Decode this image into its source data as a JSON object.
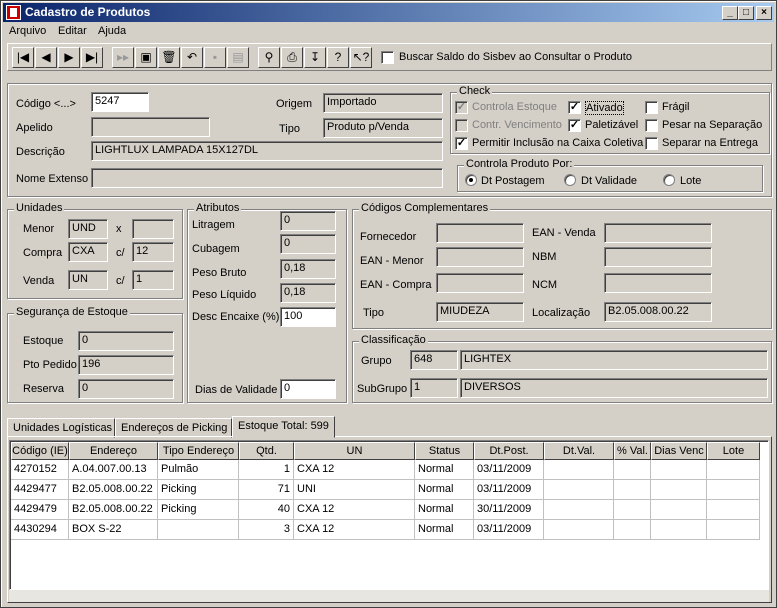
{
  "window": {
    "title": "Cadastro de Produtos"
  },
  "menu": [
    "Arquivo",
    "Editar",
    "Ajuda"
  ],
  "toolbar": {
    "buscar_label": "Buscar Saldo do Sisbev ao Consultar o Produto"
  },
  "produto": {
    "codigo_label": "Código <...>",
    "codigo": "5247",
    "apelido_label": "Apelido",
    "apelido": "",
    "descricao_label": "Descrição",
    "descricao": "LIGHTLUX LAMPADA      15X127DL",
    "nome_extenso_label": "Nome Extenso",
    "nome_extenso": "",
    "origem_label": "Origem",
    "origem": "Importado",
    "tipo_label": "Tipo",
    "tipo": "Produto p/Venda"
  },
  "check": {
    "title": "Check",
    "controla_estoque": "Controla Estoque",
    "ativado": "Ativado",
    "fragil": "Frágil",
    "contr_vencimento": "Contr. Vencimento",
    "paletizavel": "Paletizável",
    "pesar": "Pesar na Separação",
    "permitir": "Permitir Inclusão na Caixa Coletiva",
    "separar": "Separar na Entrega",
    "controla_por": "Controla Produto Por:",
    "dt_postagem": "Dt Postagem",
    "dt_validade": "Dt Validade",
    "lote": "Lote"
  },
  "unidades": {
    "title": "Unidades",
    "menor_label": "Menor",
    "menor": "UND",
    "x": "x",
    "menor_q": "",
    "compra_label": "Compra",
    "compra": "CXA",
    "c1": "c/",
    "compra_q": "12",
    "venda_label": "Venda",
    "venda": "UN",
    "c2": "c/",
    "venda_q": "1"
  },
  "seguranca": {
    "title": "Segurança de Estoque",
    "estoque_label": "Estoque",
    "estoque": "0",
    "pto_label": "Pto Pedido",
    "pto": "196",
    "reserva_label": "Reserva",
    "reserva": "0"
  },
  "atributos": {
    "title": "Atributos",
    "litragem_label": "Litragem",
    "litragem": "0",
    "cubagem_label": "Cubagem",
    "cubagem": "0",
    "peso_bruto_label": "Peso Bruto",
    "peso_bruto": "0,18",
    "peso_liq_label": "Peso Líquido",
    "peso_liq": "0,18",
    "desc_label": "Desc Encaixe (%)",
    "desc": "100",
    "dias_label": "Dias de Validade",
    "dias": "0"
  },
  "codigos": {
    "title": "Códigos Complementares",
    "fornecedor": "Fornecedor",
    "ean_menor": "EAN - Menor",
    "ean_compra": "EAN - Compra",
    "tipo_label": "Tipo",
    "tipo": "MIUDEZA",
    "ean_venda": "EAN - Venda",
    "nbm": "NBM",
    "ncm": "NCM",
    "loc_label": "Localização",
    "loc": "B2.05.008.00.22"
  },
  "classificacao": {
    "title": "Classificação",
    "grupo_label": "Grupo",
    "grupo_cod": "648",
    "grupo": "LIGHTEX",
    "sub_label": "SubGrupo",
    "sub_cod": "1",
    "sub": "DIVERSOS"
  },
  "tabs": [
    "Unidades Logísticas",
    "Endereços de Picking",
    "Estoque Total: 599"
  ],
  "table": {
    "headers": [
      "Código (IE)",
      "Endereço",
      "Tipo Endereço",
      "Qtd.",
      "UN",
      "Status",
      "Dt.Post.",
      "Dt.Val.",
      "% Val.",
      "Dias Venc",
      "Lote"
    ],
    "rows": [
      [
        "4270152",
        "A.04.007.00.13",
        "Pulmão",
        "1",
        "CXA 12",
        "Normal",
        "03/11/2009",
        "",
        "",
        "",
        ""
      ],
      [
        "4429477",
        "B2.05.008.00.22",
        "Picking",
        "71",
        "UNI",
        "Normal",
        "03/11/2009",
        "",
        "",
        "",
        ""
      ],
      [
        "4429479",
        "B2.05.008.00.22",
        "Picking",
        "40",
        "CXA 12",
        "Normal",
        "30/11/2009",
        "",
        "",
        "",
        ""
      ],
      [
        "4430294",
        "BOX S-22",
        "",
        "3",
        "CXA 12",
        "Normal",
        "03/11/2009",
        "",
        "",
        "",
        ""
      ]
    ]
  }
}
